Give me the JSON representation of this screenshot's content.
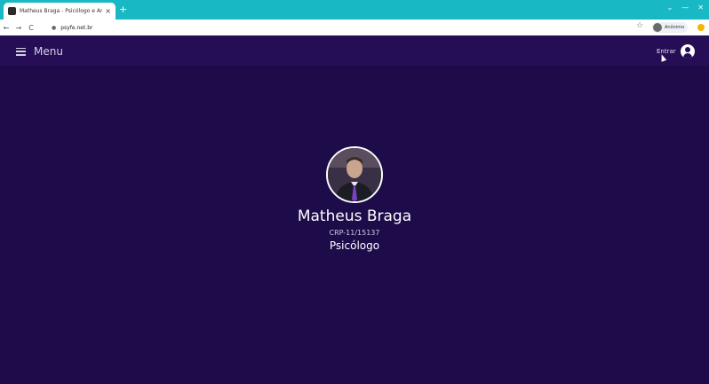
{
  "browser": {
    "tab_title": "Matheus Braga - Psicólogo e Ar...",
    "tab_close": "×",
    "new_tab": "+",
    "window_controls": [
      "⌄",
      "—",
      "✕"
    ],
    "url": "psyfe.net.br",
    "profile_name": "Anônimo",
    "nav": {
      "back": "←",
      "forward": "→",
      "reload": "C"
    },
    "icons": {
      "lock": "lock-icon",
      "star": "star-icon",
      "extension": "extension-icon"
    }
  },
  "appbar": {
    "menu_label": "Menu",
    "login_label": "Entrar",
    "background": "#260e56"
  },
  "profile": {
    "name": "Matheus Braga",
    "crp": "CRP-11/15137",
    "role": "Psicólogo"
  },
  "colors": {
    "page_background": "#1e0b4a",
    "browser_tabstrip": "#18b8c4",
    "accent_purple": "#6a4bc4"
  }
}
